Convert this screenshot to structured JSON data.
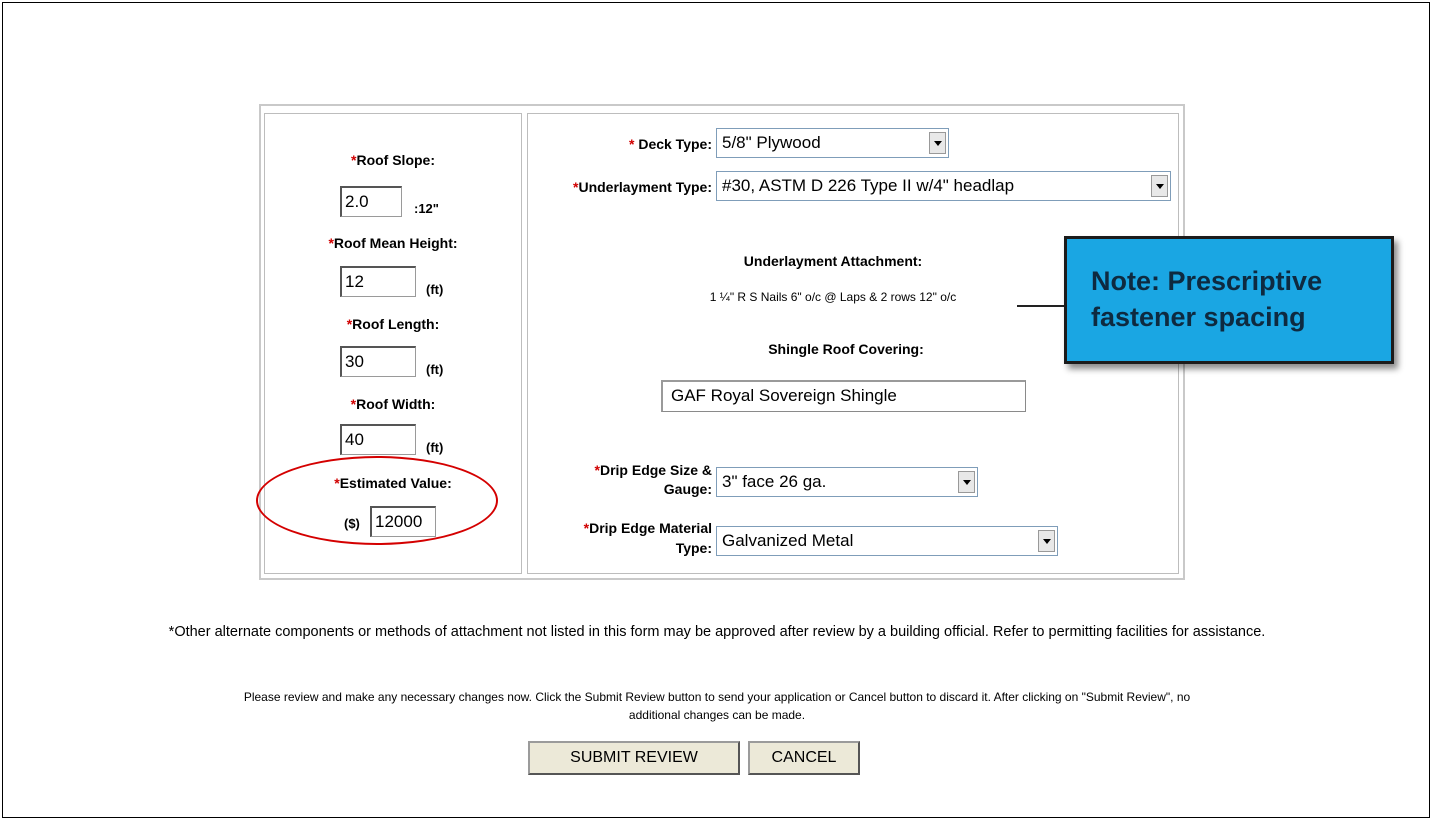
{
  "form": {
    "required_marker": "*",
    "roof_slope": {
      "label": "Roof Slope:",
      "value": "2.0",
      "unit": ":12\""
    },
    "roof_mean_height": {
      "label": "Roof Mean Height:",
      "value": "12",
      "unit": "(ft)"
    },
    "roof_length": {
      "label": "Roof Length:",
      "value": "30",
      "unit": "(ft)"
    },
    "roof_width": {
      "label": "Roof Width:",
      "value": "40",
      "unit": "(ft)"
    },
    "estimated_value": {
      "label": "Estimated Value:",
      "prefix": "($)",
      "value": "12000"
    },
    "deck_type": {
      "label": "Deck Type:",
      "value": "5/8\" Plywood"
    },
    "underlayment_type": {
      "label": "Underlayment Type:",
      "value": "#30, ASTM D 226 Type II w/4\" headlap"
    },
    "underlayment_attachment": {
      "label": "Underlayment Attachment:",
      "value": "1 ¼\" R S Nails 6\" o/c @ Laps & 2 rows 12\" o/c"
    },
    "shingle_roof_covering": {
      "label": "Shingle Roof Covering:",
      "value": "GAF Royal Sovereign Shingle"
    },
    "drip_edge_size": {
      "label_line1": "Drip Edge Size &",
      "label_line2": "Gauge:",
      "value": "3\" face 26 ga."
    },
    "drip_edge_material": {
      "label_line1": "Drip Edge Material",
      "label_line2": "Type:",
      "value": "Galvanized Metal"
    }
  },
  "callout": {
    "line1": "Note:  Prescriptive",
    "line2": "fastener spacing"
  },
  "footer": {
    "note": "*Other alternate components or methods of attachment not listed in this form may be approved after review by a building official. Refer to permitting facilities for assistance.",
    "instructions_line1": "Please review and make any necessary changes now. Click the Submit Review button to send your application or Cancel button to discard it. After clicking on \"Submit Review\", no",
    "instructions_line2": "additional changes can be made."
  },
  "buttons": {
    "submit": "SUBMIT REVIEW",
    "cancel": "CANCEL"
  },
  "colors": {
    "required": "#d00000",
    "callout_bg": "#1aa6e3",
    "highlight_circle": "#d40000"
  }
}
